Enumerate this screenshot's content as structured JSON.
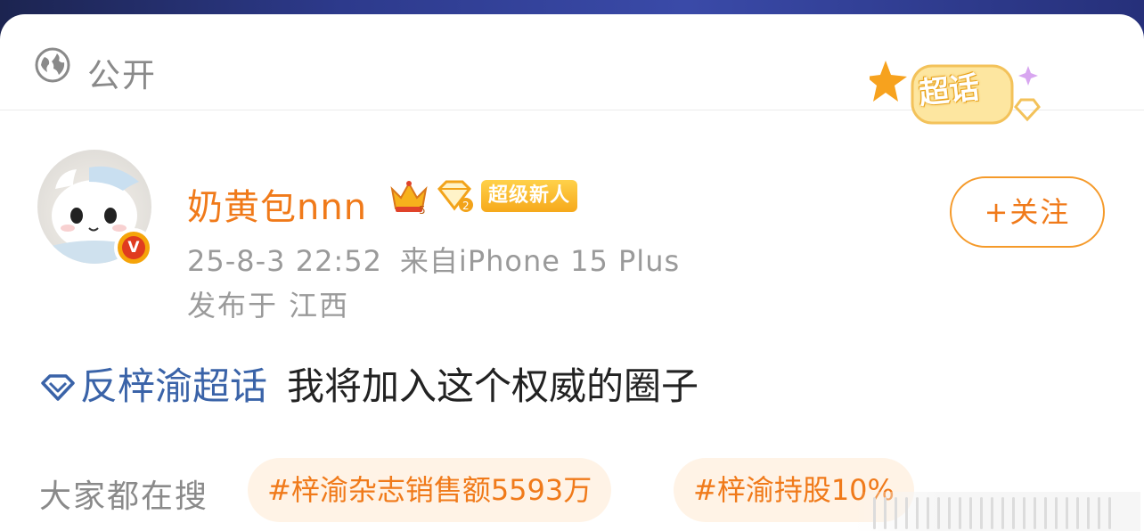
{
  "header": {
    "visibility_label": "公开",
    "super_topic_badge": "超话"
  },
  "post": {
    "author": {
      "name": "奶黄包nnn",
      "tag": "超级新人"
    },
    "timestamp": "25-8-3 22:52",
    "source": "来自iPhone 15 Plus",
    "location": "发布于 江西",
    "follow_label": "+关注",
    "topic_link": "反梓渝超话",
    "text": "我将加入这个权威的圈子"
  },
  "trending": {
    "label": "大家都在搜",
    "items": [
      "#梓渝杂志销售额5593万",
      "#梓渝持股10%"
    ]
  },
  "colors": {
    "accent_orange": "#f07a1a",
    "topic_blue": "#3a63a8",
    "badge_gold": "#f6a91b"
  },
  "icons": [
    "globe-icon",
    "crown-icon",
    "gem-level-icon",
    "verified-icon",
    "diamond-topic-icon"
  ]
}
